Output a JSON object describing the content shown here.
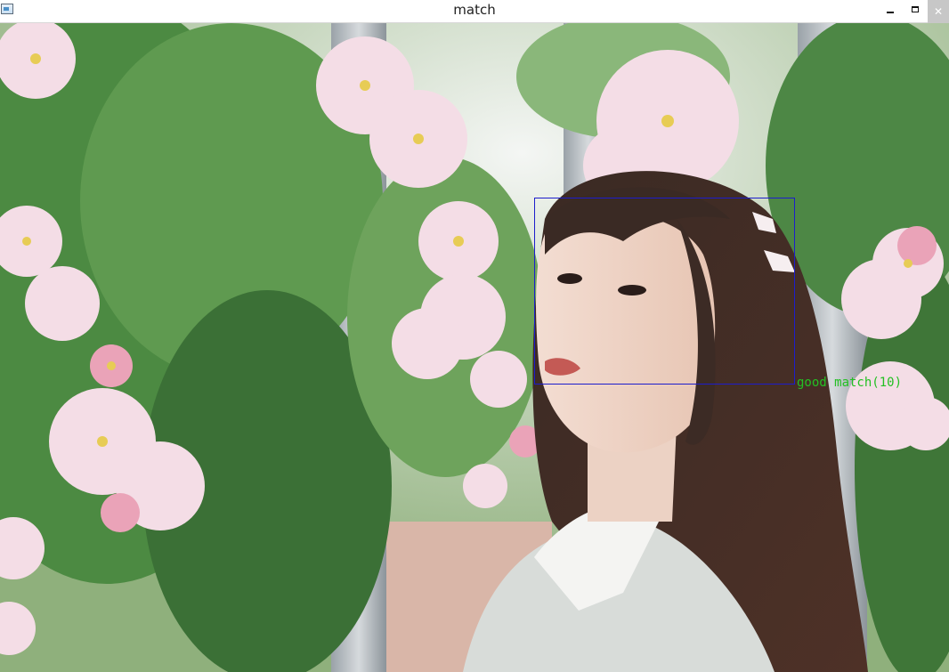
{
  "window": {
    "title": "match",
    "buttons": {
      "minimize": "minimize-icon",
      "maximize": "maximize-icon",
      "close": "close-icon"
    }
  },
  "detection": {
    "label": "good  match(10)",
    "box_color": "#1d1dcc",
    "label_color": "#23c023"
  },
  "photo": {
    "subject": "woman with long dark hair in front of pink and white climbing roses"
  },
  "colors": {
    "titlebar_bg": "#ffffff",
    "close_button_bg": "#c7c7c7"
  }
}
